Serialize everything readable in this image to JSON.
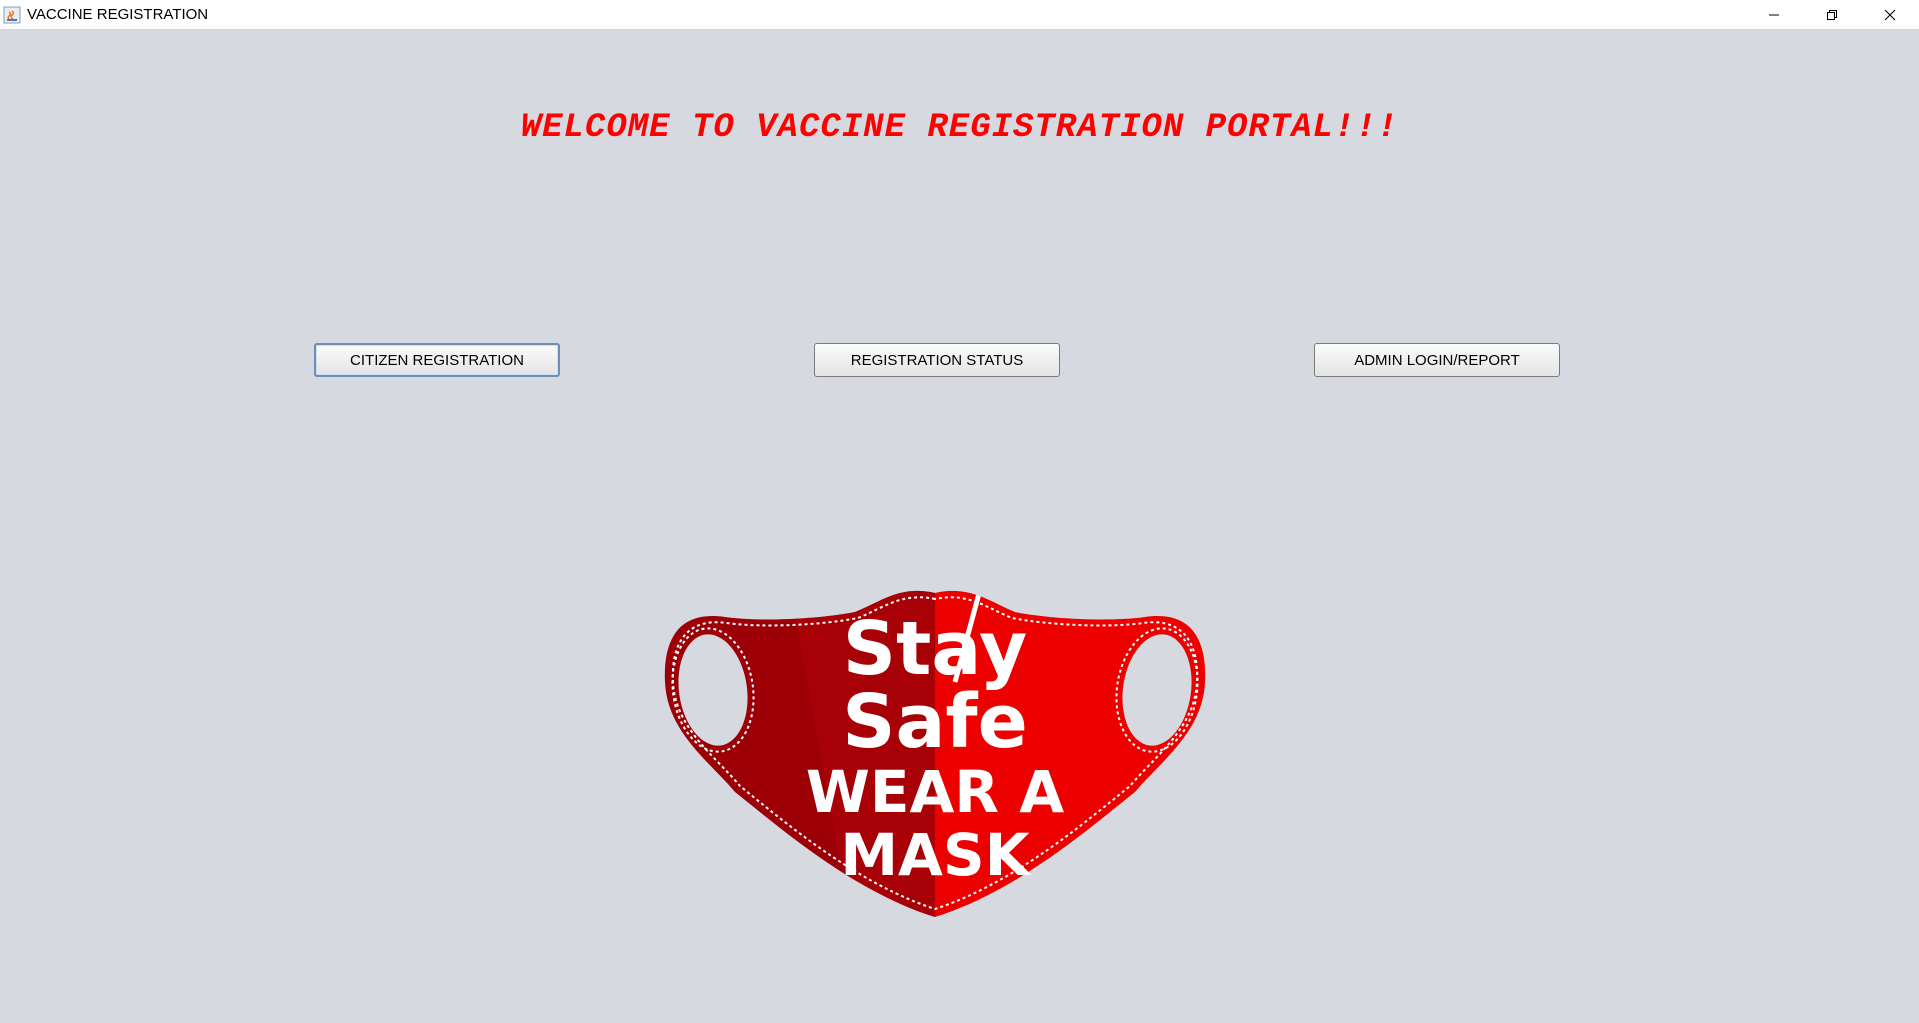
{
  "window": {
    "title": "VACCINE REGISTRATION",
    "icon": "java-app-icon",
    "controls": [
      "minimize-icon",
      "restore-icon",
      "close-icon"
    ]
  },
  "main": {
    "welcome_text": "WELCOME TO VACCINE REGISTRATION PORTAL!!!",
    "buttons": {
      "citizen_registration": "CITIZEN REGISTRATION",
      "registration_status": "REGISTRATION STATUS",
      "admin_login_report": "ADMIN LOGIN/REPORT"
    },
    "mask_image": {
      "line1": "Stay",
      "line2": "Safe",
      "line3": "WEAR A",
      "line4": "MASK"
    }
  },
  "colors": {
    "background": "#d6d9e0",
    "welcome_text": "#ff0000",
    "mask_dark": "#9c0006",
    "mask_light": "#ec0000"
  }
}
